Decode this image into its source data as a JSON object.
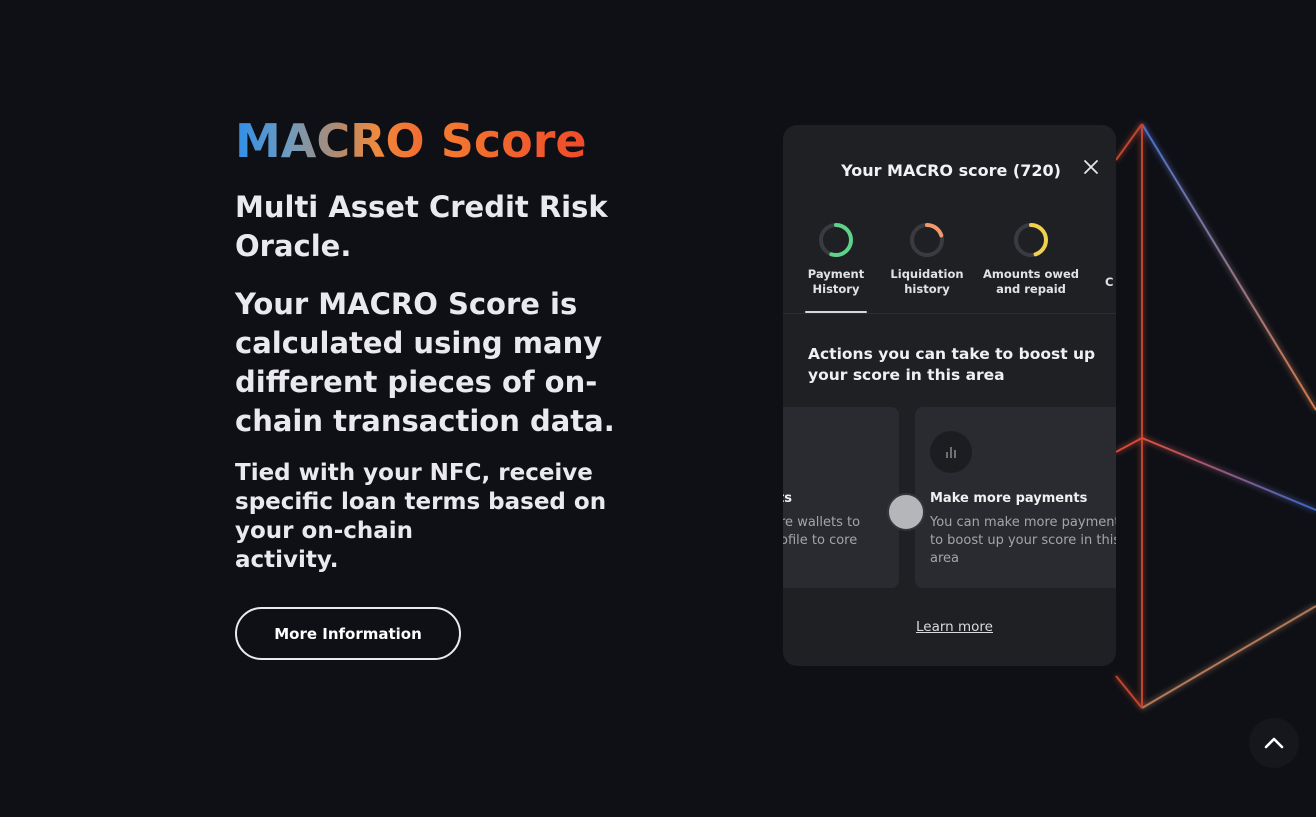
{
  "hero": {
    "brand_macro": "MACRO",
    "brand_score": "Score",
    "headline": "Multi Asset Credit Risk Oracle.",
    "subheadline": "Your MACRO Score is calculated using many different pieces of on-chain transaction data.",
    "body": "Tied with your NFC, receive specific loan terms based on your on-chain\nactivity.",
    "cta_label": "More Information"
  },
  "modal": {
    "title": "Your MACRO score (720)",
    "close_icon": "close-icon",
    "tabs": [
      {
        "label": "Payment\nHistory",
        "color": "#5fd28a",
        "progress": 0.55,
        "active": true
      },
      {
        "label": "Liquidation\nhistory",
        "color": "#f39a6c",
        "progress": 0.2,
        "active": false
      },
      {
        "label": "Amounts owed\nand repaid",
        "color": "#f2d04f",
        "progress": 0.45,
        "active": false
      },
      {
        "label": "C",
        "color": "#888888",
        "progress": 0.3,
        "active": false
      }
    ],
    "actions_title": "Actions you can take to boost up your score in this area",
    "action_cards": [
      {
        "title": "ts",
        "description": "re wallets to ofile to core",
        "icon": "bar-chart-icon"
      },
      {
        "title": "Make more payments",
        "description": "You can make more payments to boost up your score in this area",
        "icon": "bar-chart-icon"
      }
    ],
    "learn_more": "Learn more"
  },
  "scroll_top_icon": "chevron-up-icon",
  "colors": {
    "background": "#0e1016",
    "card": "#1f2024",
    "action_card": "#2a2b30"
  }
}
